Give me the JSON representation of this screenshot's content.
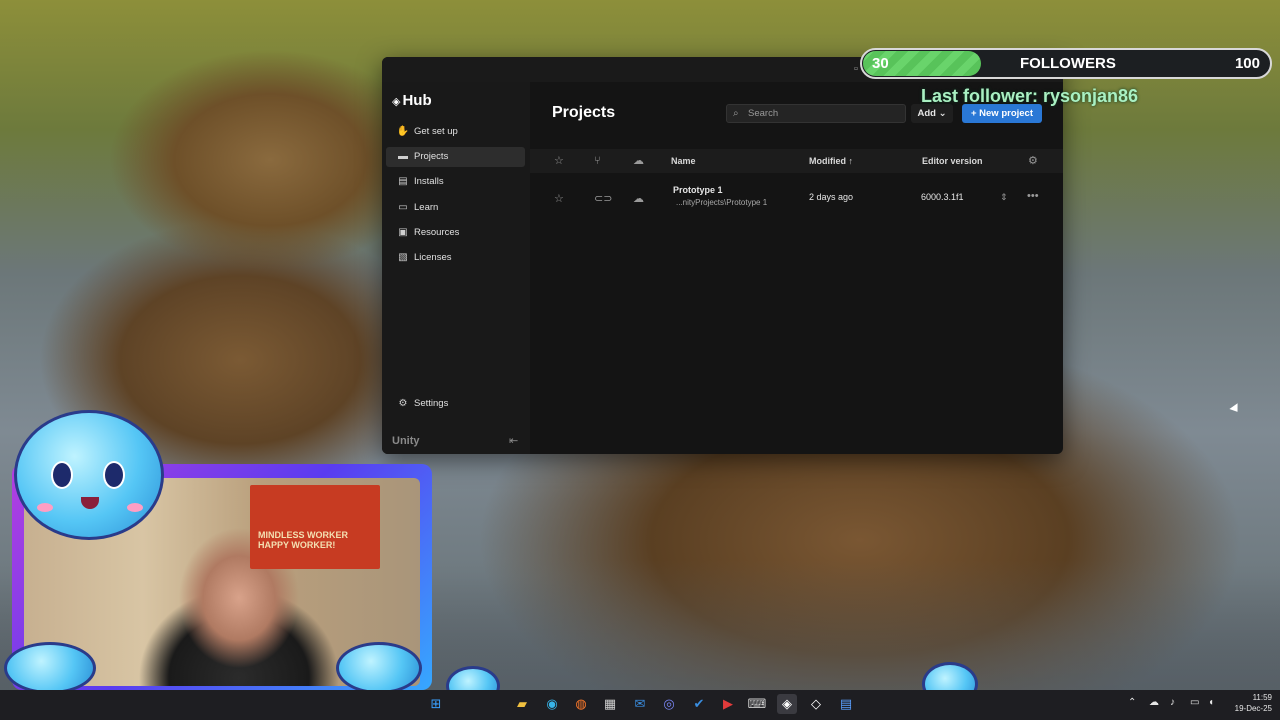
{
  "hub": {
    "logo": "Hub",
    "page_title": "Projects",
    "search_placeholder": "Search",
    "add_label": "Add",
    "new_project_label": "+ New project",
    "nav": [
      {
        "label": "Get set up",
        "icon": "wave-hand-icon"
      },
      {
        "label": "Projects",
        "icon": "folder-icon"
      },
      {
        "label": "Installs",
        "icon": "installs-icon"
      },
      {
        "label": "Learn",
        "icon": "learn-icon"
      },
      {
        "label": "Resources",
        "icon": "resources-icon"
      },
      {
        "label": "Licenses",
        "icon": "license-icon"
      }
    ],
    "settings_label": "Settings",
    "footer_brand": "Unity",
    "columns": {
      "name": "Name",
      "modified": "Modified",
      "editor_version": "Editor version"
    },
    "projects": [
      {
        "name": "Prototype 1",
        "path": "...nityProjects\\Prototype 1",
        "modified": "2 days ago",
        "editor_version": "6000.3.1f1"
      }
    ],
    "accent_color": "#2a78d6"
  },
  "overlay": {
    "followers_count": "30",
    "followers_label": "FOLLOWERS",
    "followers_goal": "100",
    "followers_progress": 0.3,
    "last_follower": "Last follower: rysonjan86",
    "poster_text_line1": "MINDLESS WORKER",
    "poster_text_line2": "HAPPY WORKER!"
  },
  "taskbar": {
    "time": "11:59",
    "date": "19-Dec-25"
  }
}
